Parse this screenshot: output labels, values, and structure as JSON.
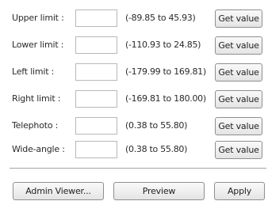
{
  "rows": [
    {
      "label": "Upper limit :",
      "value": "",
      "range": "(-89.85 to 45.93)",
      "button": "Get value"
    },
    {
      "label": "Lower limit :",
      "value": "",
      "range": "(-110.93 to 24.85)",
      "button": "Get value"
    },
    {
      "label": "Left limit :",
      "value": "",
      "range": "(-179.99 to 169.81)",
      "button": "Get value"
    },
    {
      "label": "Right limit :",
      "value": "",
      "range": "(-169.81 to 180.00)",
      "button": "Get value"
    },
    {
      "label": "Telephoto :",
      "value": "",
      "range": "(0.38 to 55.80)",
      "button": "Get value"
    },
    {
      "label": "Wide-angle :",
      "value": "",
      "range": "(0.38 to 55.80)",
      "button": "Get value"
    }
  ],
  "footer": {
    "admin_viewer": "Admin Viewer...",
    "preview": "Preview",
    "apply": "Apply"
  }
}
